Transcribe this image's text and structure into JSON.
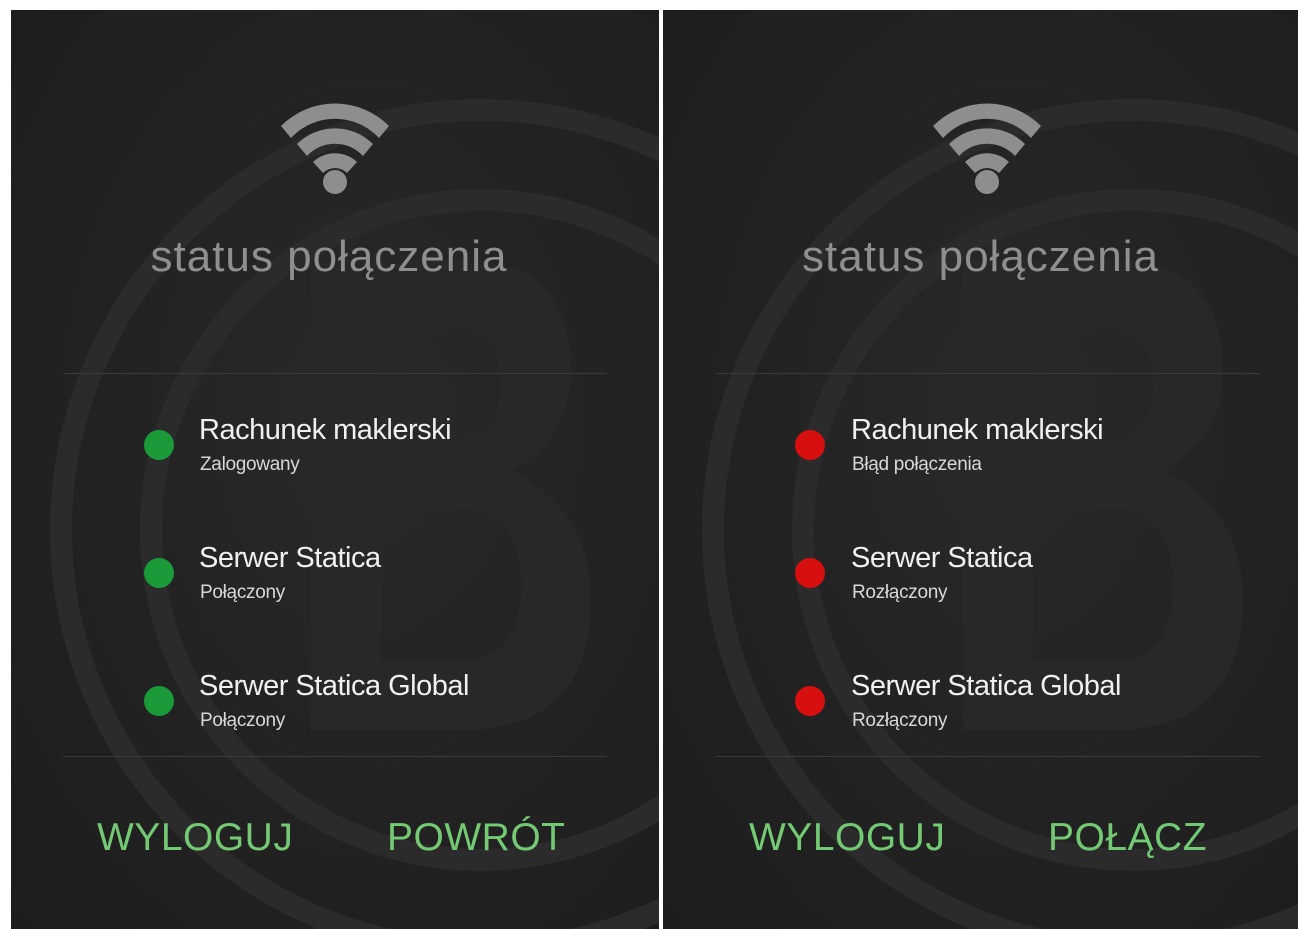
{
  "colors": {
    "ok": "#1a9a38",
    "error": "#d80f0f",
    "action": "#74c974",
    "title": "#8f8f8f"
  },
  "screens": [
    {
      "icon": "wifi-icon",
      "title": "status połączenia",
      "items": [
        {
          "name": "Rachunek maklerski",
          "state": "Zalogowany",
          "status": "ok"
        },
        {
          "name": "Serwer Statica",
          "state": "Połączony",
          "status": "ok"
        },
        {
          "name": "Serwer Statica Global",
          "state": "Połączony",
          "status": "ok"
        }
      ],
      "buttons": {
        "primary": "WYLOGUJ",
        "secondary": "POWRÓT"
      }
    },
    {
      "icon": "wifi-icon",
      "title": "status połączenia",
      "items": [
        {
          "name": "Rachunek maklerski",
          "state": "Błąd połączenia",
          "status": "error"
        },
        {
          "name": "Serwer Statica",
          "state": "Rozłączony",
          "status": "error"
        },
        {
          "name": "Serwer Statica Global",
          "state": "Rozłączony",
          "status": "error"
        }
      ],
      "buttons": {
        "primary": "WYLOGUJ",
        "secondary": "POŁĄCZ"
      }
    }
  ]
}
